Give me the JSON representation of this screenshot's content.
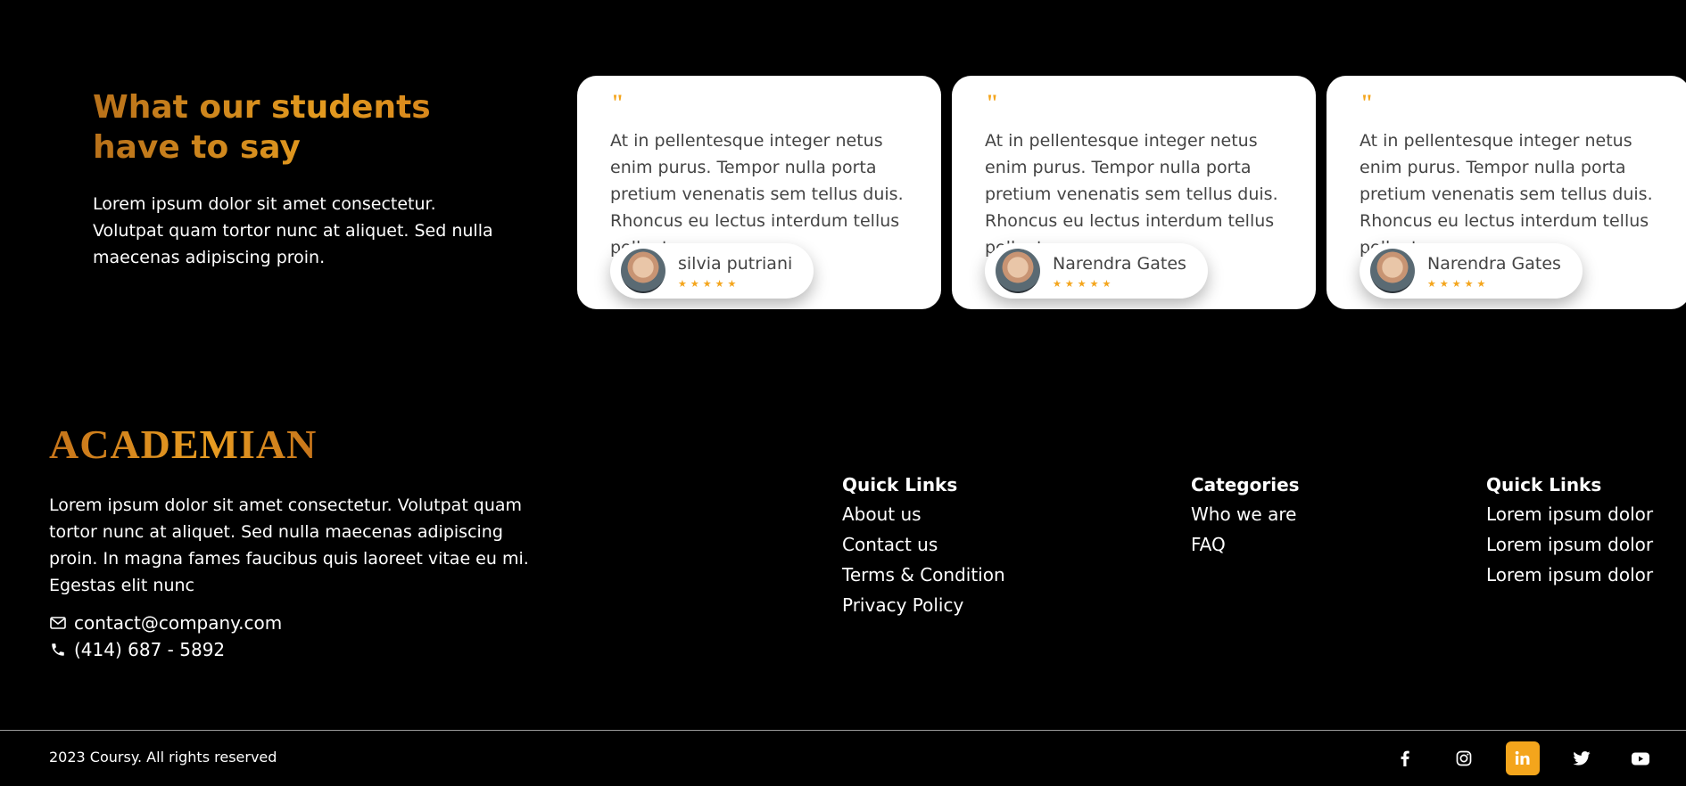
{
  "testimonials": {
    "heading": "What our students have to say",
    "subtitle": "Lorem ipsum dolor sit amet consectetur. Volutpat quam tortor nunc at aliquet. Sed nulla maecenas adipiscing proin.",
    "cards": [
      {
        "quote_mark": "\"",
        "text": "At in pellentesque integer netus enim purus. Tempor nulla porta pretium venenatis sem tellus duis. Rhoncus eu lectus interdum tellus pellentesque.",
        "author": "silvia putriani",
        "stars": "★★★★★",
        "rating": 5
      },
      {
        "quote_mark": "\"",
        "text": "At in pellentesque integer netus enim purus. Tempor nulla porta pretium venenatis sem tellus duis. Rhoncus eu lectus interdum tellus pellentesque.",
        "author": "Narendra Gates",
        "stars": "★★★★★",
        "rating": 5
      },
      {
        "quote_mark": "\"",
        "text": "At in pellentesque integer netus enim purus. Tempor nulla porta pretium venenatis sem tellus duis. Rhoncus eu lectus interdum tellus pellentesque.",
        "author": "Narendra Gates",
        "stars": "★★★★★",
        "rating": 5
      }
    ]
  },
  "footer": {
    "brand": "ACADEMIAN",
    "description": "Lorem ipsum dolor sit amet consectetur. Volutpat quam tortor nunc at aliquet. Sed nulla maecenas adipiscing proin. In magna fames faucibus quis laoreet vitae eu mi. Egestas elit nunc",
    "email": "contact@company.com",
    "phone": "(414) 687 - 5892",
    "columns": [
      {
        "title": "Quick Links",
        "links": [
          "About us",
          "Contact us",
          "Terms & Condition",
          "Privacy Policy"
        ]
      },
      {
        "title": "Categories",
        "links": [
          "Who we are",
          "FAQ"
        ]
      },
      {
        "title": "Quick Links",
        "links": [
          "Lorem ipsum dolor",
          "Lorem ipsum dolor",
          "Lorem ipsum dolor"
        ]
      }
    ],
    "copyright": "2023 Coursy. All rights reserved",
    "socials": [
      {
        "icon": "facebook-icon",
        "active": false
      },
      {
        "icon": "instagram-icon",
        "active": false
      },
      {
        "icon": "linkedin-icon",
        "active": true
      },
      {
        "icon": "twitter-icon",
        "active": false
      },
      {
        "icon": "youtube-icon",
        "active": false
      }
    ]
  },
  "colors": {
    "accent": "#f4a51c",
    "heading_gradient_start": "#b8711a",
    "background": "#000000",
    "card": "#ffffff"
  }
}
